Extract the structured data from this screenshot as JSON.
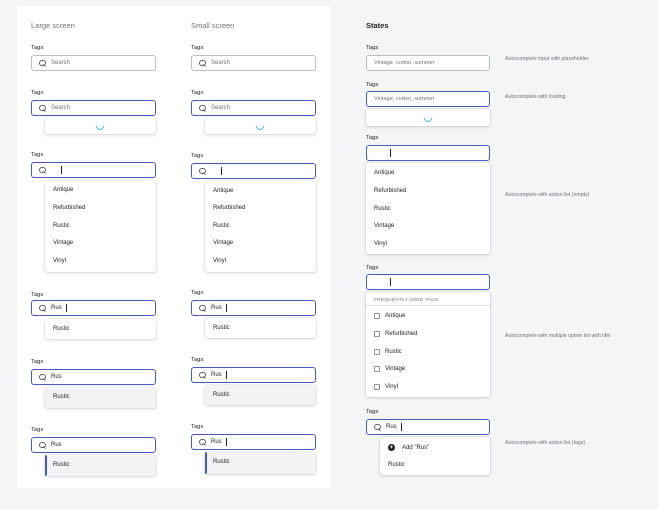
{
  "columns": {
    "large": "Large screen",
    "small": "Small screen",
    "states": "States"
  },
  "label": "Tags",
  "search_placeholder": "Search",
  "typed_value": "Rus",
  "options": [
    "Antique",
    "Refurbished",
    "Rustic",
    "Vintage",
    "Vinyl"
  ],
  "rustic": "Rustic",
  "states": {
    "placeholder_value": "Vintage, cotton, summer",
    "section_title": "FREQUENTLY USED TAGS",
    "add_action": "Add \"Rus\"",
    "notes": {
      "placeholder": "Autocomplete input with placeholder",
      "loading": "Autocomplete with loading",
      "action_empty": "Autocomplete with action list (empty)",
      "multiple": "Autocomplete with multiple option list with title",
      "action_tags": "Autocomplete with action list (tags)"
    }
  },
  "colors": {
    "focus": "#4959bd",
    "spinner": "#47c1bf",
    "background": "#f4f5f7"
  }
}
